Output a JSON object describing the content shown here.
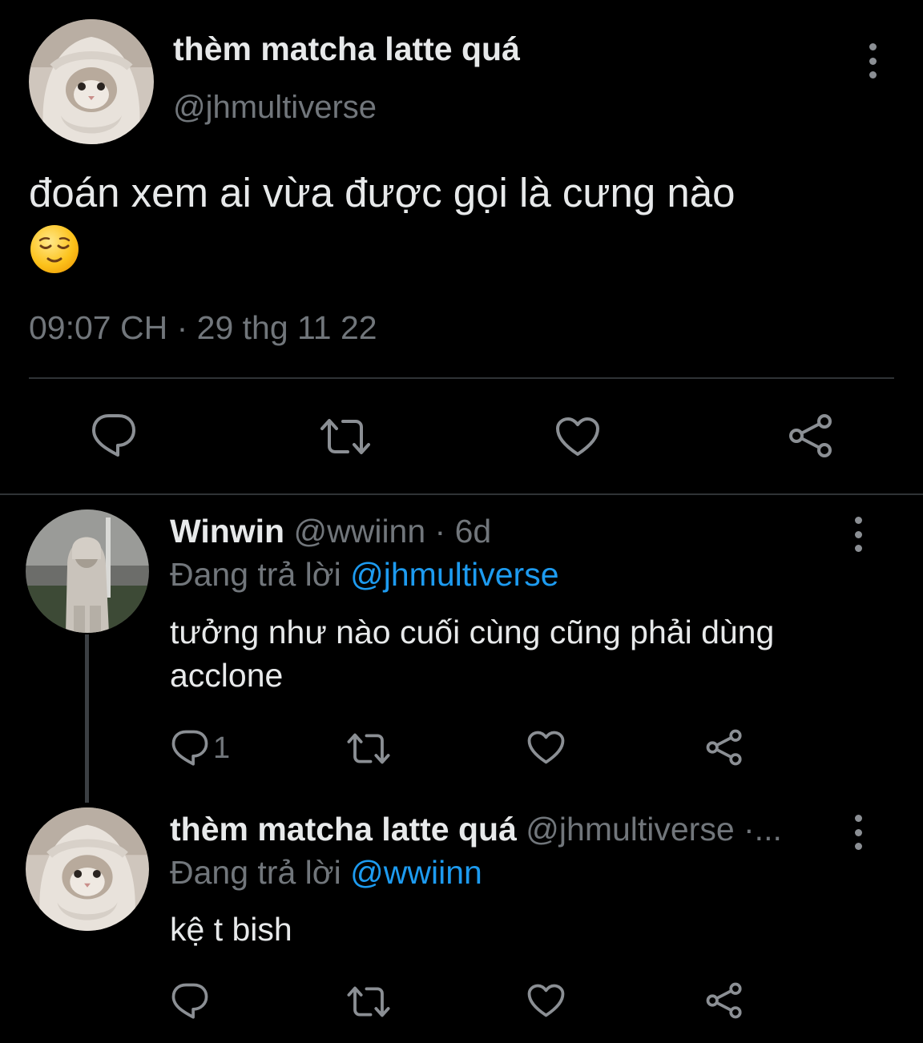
{
  "main_tweet": {
    "display_name": "thèm matcha latte quá",
    "handle": "@jhmultiverse",
    "text": "đoán xem ai vừa được gọi là cưng nào",
    "emoji": "relieved-face",
    "timestamp": "09:07 CH · 29 thg 11 22",
    "actions": [
      "reply-icon",
      "retweet-icon",
      "like-icon",
      "share-icon"
    ]
  },
  "replies": [
    {
      "display_name": "Winwin",
      "meta": " @wwiinn · 6d",
      "replying_prefix": "Đang trả lời ",
      "replying_to": "@jhmultiverse",
      "text": "tưởng như nào cuối cùng cũng phải dùng acclone",
      "reply_count": "1"
    },
    {
      "display_name": "thèm matcha latte quá",
      "meta": " @jhmultiverse ·...",
      "replying_prefix": "Đang trả lời ",
      "replying_to": "@wwiinn",
      "text": "kệ t bish",
      "reply_count": ""
    }
  ],
  "colors": {
    "background": "#000000",
    "text": "#e7e9ea",
    "muted": "#71767b",
    "accent": "#1d9bf0",
    "divider": "#2f3336"
  }
}
